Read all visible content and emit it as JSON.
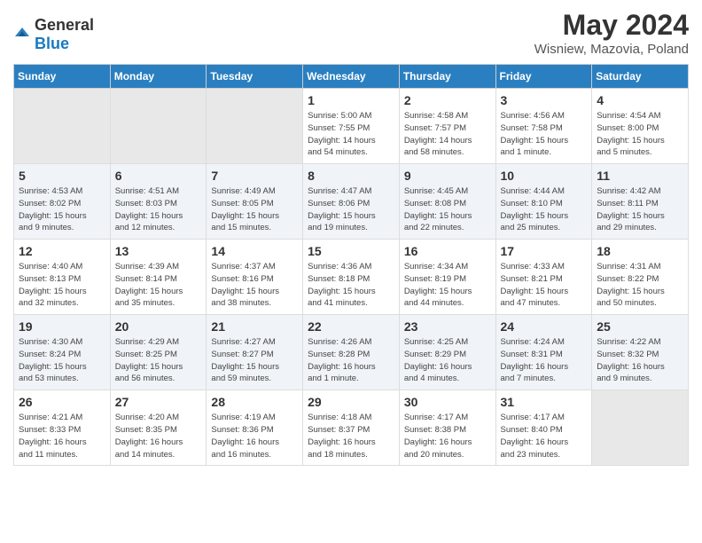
{
  "logo": {
    "text_general": "General",
    "text_blue": "Blue"
  },
  "title": "May 2024",
  "subtitle": "Wisniew, Mazovia, Poland",
  "days_of_week": [
    "Sunday",
    "Monday",
    "Tuesday",
    "Wednesday",
    "Thursday",
    "Friday",
    "Saturday"
  ],
  "weeks": [
    [
      {
        "day": "",
        "info": ""
      },
      {
        "day": "",
        "info": ""
      },
      {
        "day": "",
        "info": ""
      },
      {
        "day": "1",
        "info": "Sunrise: 5:00 AM\nSunset: 7:55 PM\nDaylight: 14 hours\nand 54 minutes."
      },
      {
        "day": "2",
        "info": "Sunrise: 4:58 AM\nSunset: 7:57 PM\nDaylight: 14 hours\nand 58 minutes."
      },
      {
        "day": "3",
        "info": "Sunrise: 4:56 AM\nSunset: 7:58 PM\nDaylight: 15 hours\nand 1 minute."
      },
      {
        "day": "4",
        "info": "Sunrise: 4:54 AM\nSunset: 8:00 PM\nDaylight: 15 hours\nand 5 minutes."
      }
    ],
    [
      {
        "day": "5",
        "info": "Sunrise: 4:53 AM\nSunset: 8:02 PM\nDaylight: 15 hours\nand 9 minutes."
      },
      {
        "day": "6",
        "info": "Sunrise: 4:51 AM\nSunset: 8:03 PM\nDaylight: 15 hours\nand 12 minutes."
      },
      {
        "day": "7",
        "info": "Sunrise: 4:49 AM\nSunset: 8:05 PM\nDaylight: 15 hours\nand 15 minutes."
      },
      {
        "day": "8",
        "info": "Sunrise: 4:47 AM\nSunset: 8:06 PM\nDaylight: 15 hours\nand 19 minutes."
      },
      {
        "day": "9",
        "info": "Sunrise: 4:45 AM\nSunset: 8:08 PM\nDaylight: 15 hours\nand 22 minutes."
      },
      {
        "day": "10",
        "info": "Sunrise: 4:44 AM\nSunset: 8:10 PM\nDaylight: 15 hours\nand 25 minutes."
      },
      {
        "day": "11",
        "info": "Sunrise: 4:42 AM\nSunset: 8:11 PM\nDaylight: 15 hours\nand 29 minutes."
      }
    ],
    [
      {
        "day": "12",
        "info": "Sunrise: 4:40 AM\nSunset: 8:13 PM\nDaylight: 15 hours\nand 32 minutes."
      },
      {
        "day": "13",
        "info": "Sunrise: 4:39 AM\nSunset: 8:14 PM\nDaylight: 15 hours\nand 35 minutes."
      },
      {
        "day": "14",
        "info": "Sunrise: 4:37 AM\nSunset: 8:16 PM\nDaylight: 15 hours\nand 38 minutes."
      },
      {
        "day": "15",
        "info": "Sunrise: 4:36 AM\nSunset: 8:18 PM\nDaylight: 15 hours\nand 41 minutes."
      },
      {
        "day": "16",
        "info": "Sunrise: 4:34 AM\nSunset: 8:19 PM\nDaylight: 15 hours\nand 44 minutes."
      },
      {
        "day": "17",
        "info": "Sunrise: 4:33 AM\nSunset: 8:21 PM\nDaylight: 15 hours\nand 47 minutes."
      },
      {
        "day": "18",
        "info": "Sunrise: 4:31 AM\nSunset: 8:22 PM\nDaylight: 15 hours\nand 50 minutes."
      }
    ],
    [
      {
        "day": "19",
        "info": "Sunrise: 4:30 AM\nSunset: 8:24 PM\nDaylight: 15 hours\nand 53 minutes."
      },
      {
        "day": "20",
        "info": "Sunrise: 4:29 AM\nSunset: 8:25 PM\nDaylight: 15 hours\nand 56 minutes."
      },
      {
        "day": "21",
        "info": "Sunrise: 4:27 AM\nSunset: 8:27 PM\nDaylight: 15 hours\nand 59 minutes."
      },
      {
        "day": "22",
        "info": "Sunrise: 4:26 AM\nSunset: 8:28 PM\nDaylight: 16 hours\nand 1 minute."
      },
      {
        "day": "23",
        "info": "Sunrise: 4:25 AM\nSunset: 8:29 PM\nDaylight: 16 hours\nand 4 minutes."
      },
      {
        "day": "24",
        "info": "Sunrise: 4:24 AM\nSunset: 8:31 PM\nDaylight: 16 hours\nand 7 minutes."
      },
      {
        "day": "25",
        "info": "Sunrise: 4:22 AM\nSunset: 8:32 PM\nDaylight: 16 hours\nand 9 minutes."
      }
    ],
    [
      {
        "day": "26",
        "info": "Sunrise: 4:21 AM\nSunset: 8:33 PM\nDaylight: 16 hours\nand 11 minutes."
      },
      {
        "day": "27",
        "info": "Sunrise: 4:20 AM\nSunset: 8:35 PM\nDaylight: 16 hours\nand 14 minutes."
      },
      {
        "day": "28",
        "info": "Sunrise: 4:19 AM\nSunset: 8:36 PM\nDaylight: 16 hours\nand 16 minutes."
      },
      {
        "day": "29",
        "info": "Sunrise: 4:18 AM\nSunset: 8:37 PM\nDaylight: 16 hours\nand 18 minutes."
      },
      {
        "day": "30",
        "info": "Sunrise: 4:17 AM\nSunset: 8:38 PM\nDaylight: 16 hours\nand 20 minutes."
      },
      {
        "day": "31",
        "info": "Sunrise: 4:17 AM\nSunset: 8:40 PM\nDaylight: 16 hours\nand 23 minutes."
      },
      {
        "day": "",
        "info": ""
      }
    ]
  ]
}
